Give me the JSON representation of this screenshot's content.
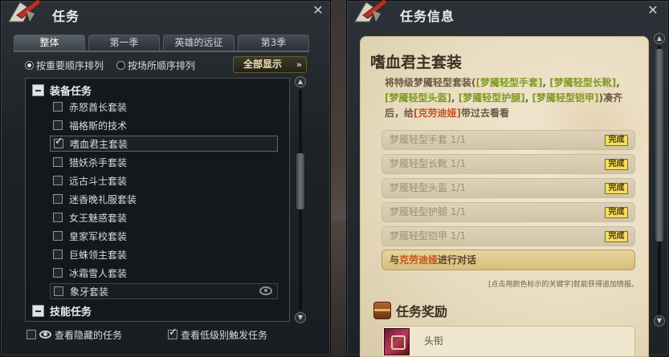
{
  "left_window": {
    "title": "任务",
    "tabs": [
      "整体",
      "第一季",
      "英雄的远征",
      "第3季"
    ],
    "sort_options": [
      "按重要顺序排列",
      "按场所顺序排列"
    ],
    "show_all": "全部显示",
    "categories": [
      "装备任务",
      "技能任务"
    ],
    "items": [
      {
        "label": "赤怒酋长套装",
        "checked": false
      },
      {
        "label": "福格斯的技术",
        "checked": false
      },
      {
        "label": "嗜血君主套装",
        "checked": true
      },
      {
        "label": "猎妖杀手套装",
        "checked": false
      },
      {
        "label": "远古斗士套装",
        "checked": false
      },
      {
        "label": "迷香晚礼服套装",
        "checked": false
      },
      {
        "label": "女王魅惑套装",
        "checked": false
      },
      {
        "label": "皇家军校套装",
        "checked": false
      },
      {
        "label": "巨蛛领主套装",
        "checked": false
      },
      {
        "label": "冰霜雪人套装",
        "checked": false
      },
      {
        "label": "象牙套装",
        "checked": false
      }
    ],
    "footer": {
      "hidden_quests": "查看隐藏的任务",
      "low_level_quests": "查看低级别触发任务"
    }
  },
  "right_window": {
    "title": "任务信息",
    "quest_title": "嗜血君主套装",
    "description": {
      "p1": "将特级梦魇轻型套装(",
      "g1": "[梦魇轻型手套]",
      "s1": ", ",
      "g2": "[梦魇轻型长靴]",
      "s2": ", ",
      "g3": "[梦魇轻型头盔]",
      "s3": ", ",
      "g4": "[梦魇轻型护腿]",
      "s4": ", ",
      "g5": "[梦魇轻型铠甲]",
      "p2": ")凑齐后，给",
      "npc": "[克劳迪娅]",
      "p3": "带过去看看"
    },
    "objectives": [
      {
        "label": "梦魇轻型手套 1/1",
        "status": "完成"
      },
      {
        "label": "梦魇轻型长靴 1/1",
        "status": "完成"
      },
      {
        "label": "梦魇轻型头盔 1/1",
        "status": "完成"
      },
      {
        "label": "梦魇轻型护腿 1/1",
        "status": "完成"
      },
      {
        "label": "梦魇轻型铠甲 1/1",
        "status": "完成"
      }
    ],
    "talk": {
      "prefix": "与",
      "npc": "克劳迪娅",
      "suffix": "进行对话"
    },
    "hint": "[点击用颜色标示的关键字]就能获得追加情报。",
    "reward_header": "任务奖励",
    "reward_item": "头衔"
  },
  "icons": {
    "close": "close-icon",
    "scroll_up": "chevron-up-icon",
    "scroll_down": "chevron-down-icon",
    "eye": "eye-icon",
    "chest": "treasure-chest-icon"
  },
  "colors": {
    "highlight_green": "#7e9a1e",
    "highlight_orange": "#c2541e",
    "done_badge": "#f6df5b"
  }
}
